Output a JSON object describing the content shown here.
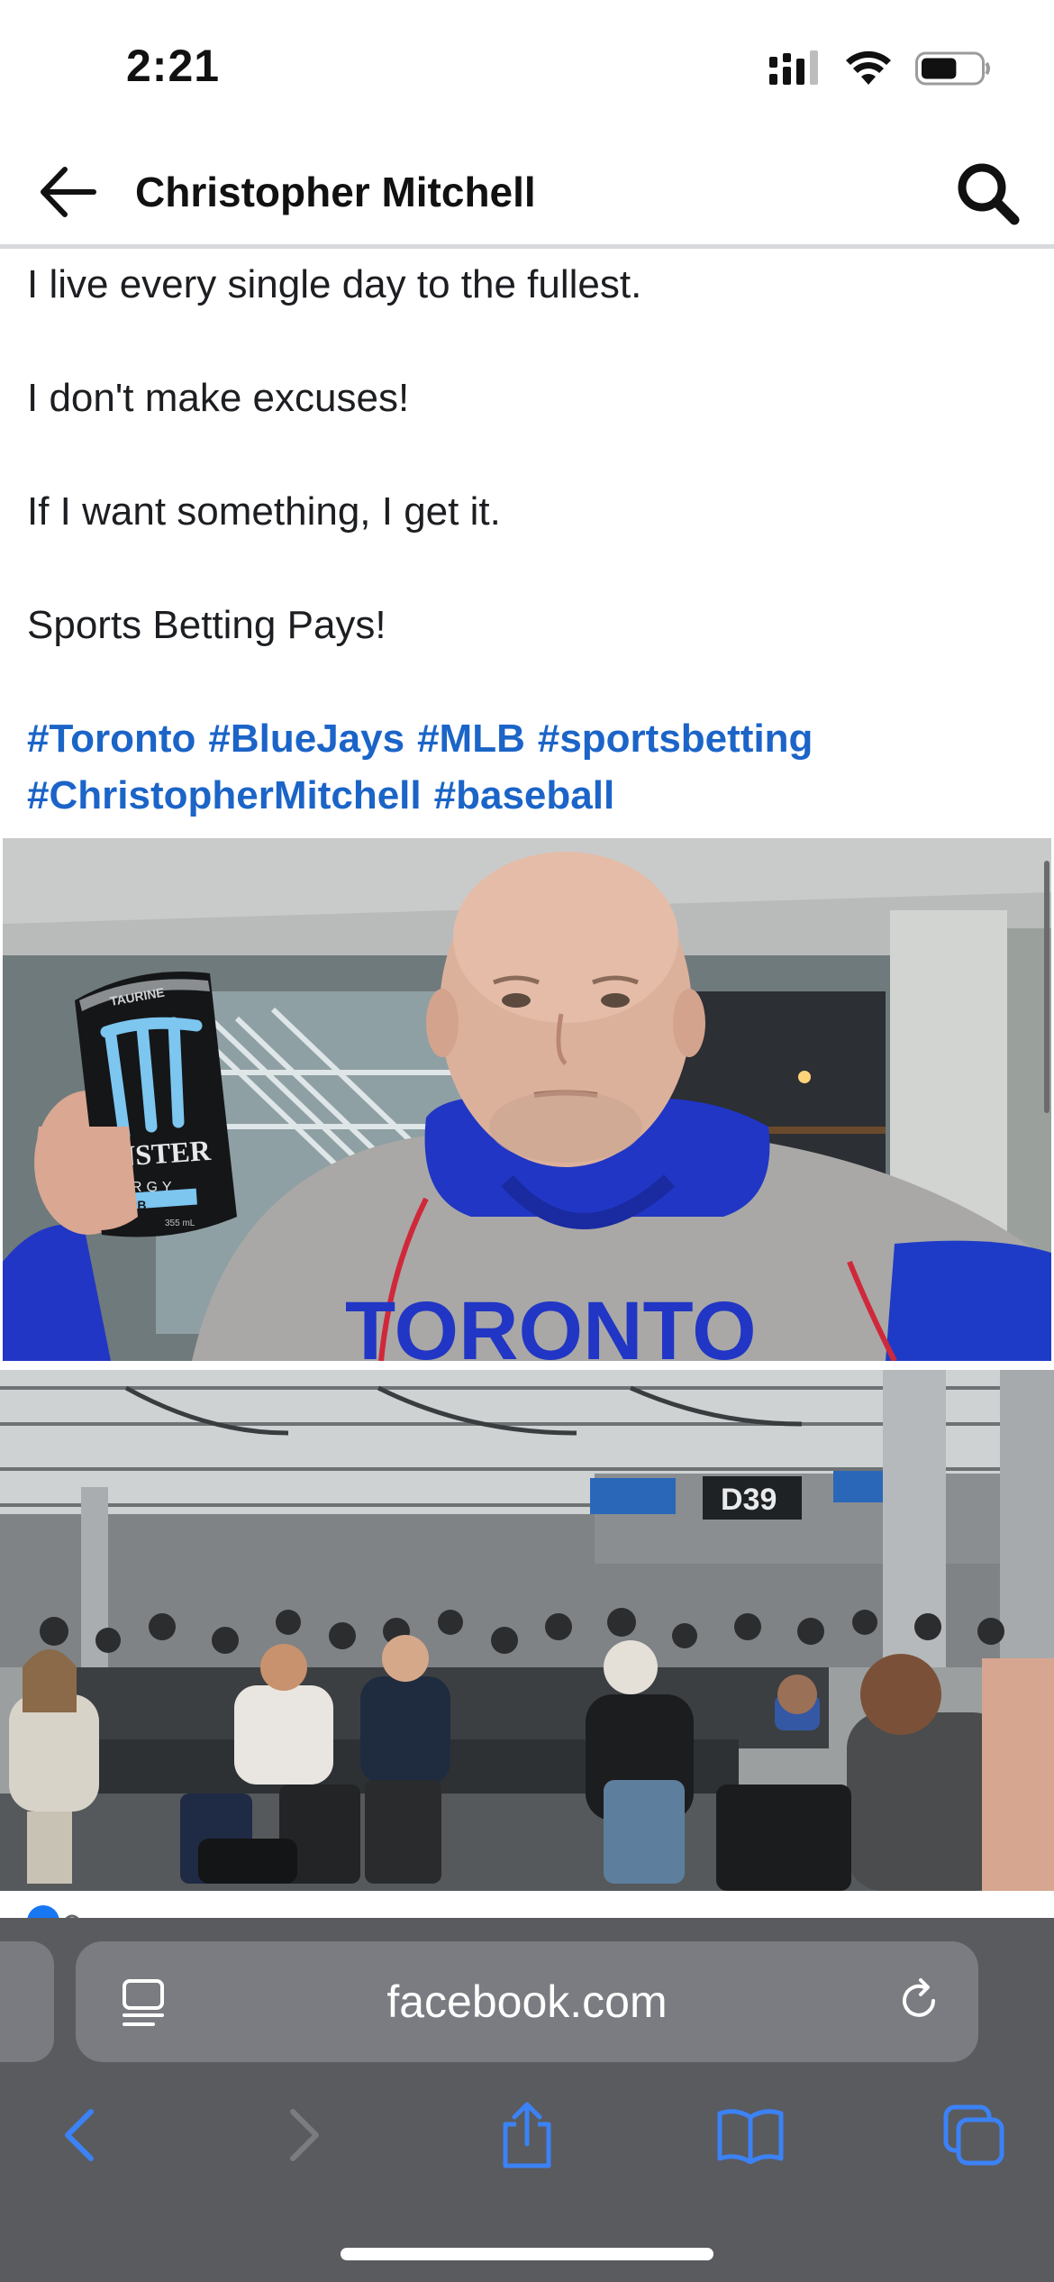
{
  "status_bar": {
    "time": "2:21",
    "battery_level": 0.6
  },
  "header": {
    "title": "Christopher Mitchell"
  },
  "post": {
    "lines": [
      "I live every single day to the fullest.",
      "I don't make excuses!",
      "If I want something, I get it.",
      "Sports Betting Pays!"
    ],
    "hashtags": [
      "#Toronto",
      "#BlueJays",
      "#MLB",
      "#sportsbetting",
      "#ChristopherMitchell",
      "#baseball"
    ],
    "photo_1": {
      "can_brand": "MONSTER",
      "can_sub": "ENERGY",
      "can_flavor": "LO-CARB",
      "can_top": "TAURINE",
      "can_size": "355 mL",
      "shirt_text": "TORONTO"
    },
    "photo_2": {
      "gate_sign": "D39"
    }
  },
  "browser": {
    "url": "facebook.com",
    "accent_color": "#3b82f6"
  }
}
